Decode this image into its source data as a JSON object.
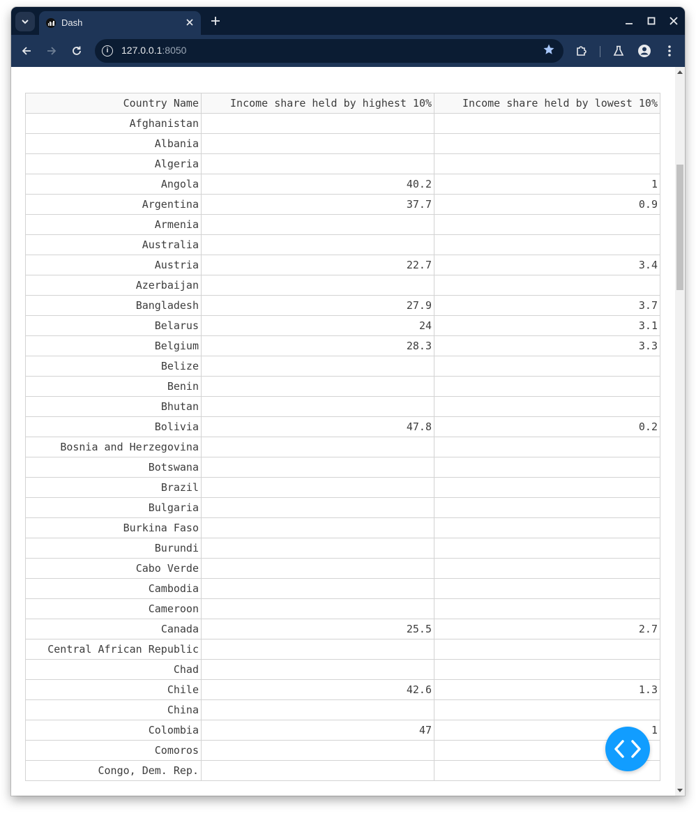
{
  "browser": {
    "tab_title": "Dash",
    "url_host": "127.0.0.1",
    "url_port": ":8050",
    "icons": {
      "tab_search": "chevron-down-icon",
      "tab_close": "close-icon",
      "new_tab": "plus-icon",
      "minimize": "minimize-icon",
      "maximize": "maximize-icon",
      "close_window": "close-icon",
      "back": "arrow-left-icon",
      "forward": "arrow-right-icon",
      "reload": "reload-icon",
      "site_info": "info-icon",
      "bookmark": "star-icon",
      "extensions": "puzzle-icon",
      "labs": "flask-icon",
      "profile": "person-icon",
      "menu": "kebab-menu-icon"
    }
  },
  "table": {
    "headers": [
      "Country Name",
      "Income share held by highest 10%",
      "Income share held by lowest 10%"
    ],
    "rows": [
      [
        "Afghanistan",
        "",
        ""
      ],
      [
        "Albania",
        "",
        ""
      ],
      [
        "Algeria",
        "",
        ""
      ],
      [
        "Angola",
        "40.2",
        "1"
      ],
      [
        "Argentina",
        "37.7",
        "0.9"
      ],
      [
        "Armenia",
        "",
        ""
      ],
      [
        "Australia",
        "",
        ""
      ],
      [
        "Austria",
        "22.7",
        "3.4"
      ],
      [
        "Azerbaijan",
        "",
        ""
      ],
      [
        "Bangladesh",
        "27.9",
        "3.7"
      ],
      [
        "Belarus",
        "24",
        "3.1"
      ],
      [
        "Belgium",
        "28.3",
        "3.3"
      ],
      [
        "Belize",
        "",
        ""
      ],
      [
        "Benin",
        "",
        ""
      ],
      [
        "Bhutan",
        "",
        ""
      ],
      [
        "Bolivia",
        "47.8",
        "0.2"
      ],
      [
        "Bosnia and Herzegovina",
        "",
        ""
      ],
      [
        "Botswana",
        "",
        ""
      ],
      [
        "Brazil",
        "",
        ""
      ],
      [
        "Bulgaria",
        "",
        ""
      ],
      [
        "Burkina Faso",
        "",
        ""
      ],
      [
        "Burundi",
        "",
        ""
      ],
      [
        "Cabo Verde",
        "",
        ""
      ],
      [
        "Cambodia",
        "",
        ""
      ],
      [
        "Cameroon",
        "",
        ""
      ],
      [
        "Canada",
        "25.5",
        "2.7"
      ],
      [
        "Central African Republic",
        "",
        ""
      ],
      [
        "Chad",
        "",
        ""
      ],
      [
        "Chile",
        "42.6",
        "1.3"
      ],
      [
        "China",
        "",
        ""
      ],
      [
        "Colombia",
        "47",
        "1"
      ],
      [
        "Comoros",
        "",
        ""
      ],
      [
        "Congo, Dem. Rep.",
        "",
        ""
      ]
    ]
  },
  "debug": {
    "icon": "code-brackets-icon",
    "color": "#119dff"
  }
}
